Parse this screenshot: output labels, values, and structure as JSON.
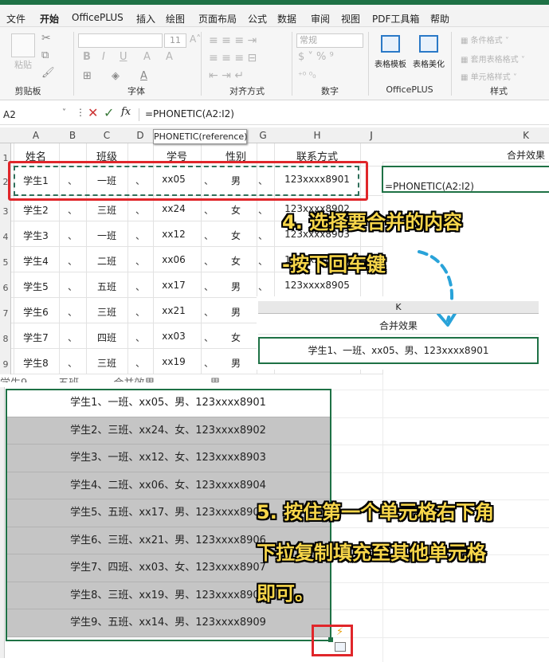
{
  "tabs": [
    "文件",
    "开始",
    "OfficePLUS",
    "插入",
    "绘图",
    "页面布局",
    "公式",
    "数据",
    "审阅",
    "视图",
    "PDF工具箱",
    "帮助"
  ],
  "ribbon": {
    "groups": [
      "剪贴板",
      "字体",
      "对齐方式",
      "数字",
      "OfficePLUS",
      "样式"
    ],
    "paste": "粘贴",
    "font_size": "11",
    "number_format": "常规",
    "officeplus_items": [
      "表格模板",
      "表格美化"
    ],
    "style_items": [
      "条件格式",
      "套用表格格式",
      "单元格样式"
    ],
    "font_buttons": [
      "B",
      "I",
      "U",
      "A",
      "A"
    ]
  },
  "formula_bar": {
    "name_box": "A2",
    "fx": "fx",
    "formula": "=PHONETIC(A2:I2)"
  },
  "tooltip": "PHONETIC(reference)",
  "columns": [
    "A",
    "B",
    "C",
    "D",
    "E",
    "F",
    "G",
    "H",
    "I",
    "J",
    "K"
  ],
  "rows": [
    "1",
    "2",
    "3",
    "4",
    "5",
    "6",
    "7",
    "8",
    "9"
  ],
  "headers": {
    "name": "姓名",
    "class": "班级",
    "id": "学号",
    "gender": "性别",
    "contact": "联系方式",
    "merged": "合并效果"
  },
  "students": [
    {
      "name": "学生1",
      "class": "一班",
      "id": "xx05",
      "gender": "男",
      "contact": "123xxxx8901"
    },
    {
      "name": "学生2",
      "class": "三班",
      "id": "xx24",
      "gender": "女",
      "contact": "123xxxx8902"
    },
    {
      "name": "学生3",
      "class": "一班",
      "id": "xx12",
      "gender": "女",
      "contact": "123xxxx8903"
    },
    {
      "name": "学生4",
      "class": "二班",
      "id": "xx06",
      "gender": "女",
      "contact": "123xxxx8904"
    },
    {
      "name": "学生5",
      "class": "五班",
      "id": "xx17",
      "gender": "男",
      "contact": "123xxxx8905"
    },
    {
      "name": "学生6",
      "class": "三班",
      "id": "xx21",
      "gender": "男",
      "contact": ""
    },
    {
      "name": "学生7",
      "class": "四班",
      "id": "xx03",
      "gender": "女",
      "contact": ""
    },
    {
      "name": "学生8",
      "class": "三班",
      "id": "xx19",
      "gender": "男",
      "contact": ""
    }
  ],
  "separator": "、",
  "k2_formula": "=PHONETIC(A2:I2)",
  "step4_line1": "4. 选择要合并的内容",
  "step4_line2": "-按下回车键",
  "zoom_col": "K",
  "zoom_header": "合并效果",
  "zoom_value": "学生1、一班、xx05、男、123xxxx8901",
  "list_items": [
    "学生1、一班、xx05、男、123xxxx8901",
    "学生2、三班、xx24、女、123xxxx8902",
    "学生3、一班、xx12、女、123xxxx8903",
    "学生4、二班、xx06、女、123xxxx8904",
    "学生5、五班、xx17、男、123xxxx8905",
    "学生6、三班、xx21、男、123xxxx8906",
    "学生7、四班、xx03、女、123xxxx8907",
    "学生8、三班、xx19、男、123xxxx8908",
    "学生9、五班、xx14、男、123xxxx8909"
  ],
  "step5_line1": "5. 按住第一个单元格右下角",
  "step5_line2": "下拉复制填充至其他单元格",
  "step5_line3": "即可。",
  "colors": {
    "accent": "#1e7145",
    "highlight": "#e0262a",
    "callout": "#f7d64a",
    "arrow": "#29a3d9"
  }
}
